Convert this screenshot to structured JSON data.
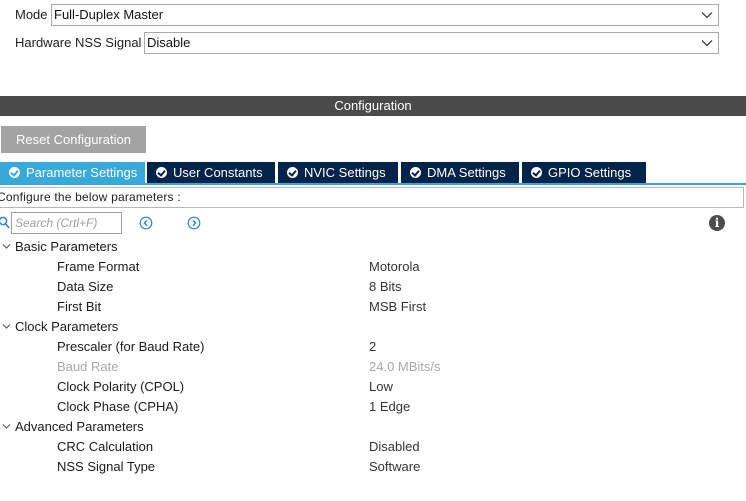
{
  "mode": {
    "label": "Mode",
    "value": "Full-Duplex Master"
  },
  "nss": {
    "label": "Hardware NSS Signal",
    "value": "Disable"
  },
  "config_header": "Configuration",
  "reset_button": "Reset Configuration",
  "tabs": [
    {
      "label": "Parameter Settings",
      "active": true
    },
    {
      "label": "User Constants",
      "active": false
    },
    {
      "label": "NVIC Settings",
      "active": false
    },
    {
      "label": "DMA Settings",
      "active": false
    },
    {
      "label": "GPIO Settings",
      "active": false
    }
  ],
  "hint": "Configure the below parameters :",
  "search": {
    "placeholder": "Search (Crtl+F)"
  },
  "groups": [
    {
      "label": "Basic Parameters",
      "params": [
        {
          "name": "Frame Format",
          "value": "Motorola",
          "disabled": false
        },
        {
          "name": "Data Size",
          "value": "8 Bits",
          "disabled": false
        },
        {
          "name": "First Bit",
          "value": "MSB First",
          "disabled": false
        }
      ]
    },
    {
      "label": "Clock Parameters",
      "params": [
        {
          "name": "Prescaler (for Baud Rate)",
          "value": "2",
          "disabled": false
        },
        {
          "name": "Baud Rate",
          "value": "24.0 MBits/s",
          "disabled": true
        },
        {
          "name": "Clock Polarity (CPOL)",
          "value": "Low",
          "disabled": false
        },
        {
          "name": "Clock Phase (CPHA)",
          "value": "1 Edge",
          "disabled": false
        }
      ]
    },
    {
      "label": "Advanced Parameters",
      "params": [
        {
          "name": "CRC Calculation",
          "value": "Disabled",
          "disabled": false
        },
        {
          "name": "NSS Signal Type",
          "value": "Software",
          "disabled": false
        }
      ]
    }
  ],
  "colors": {
    "tab_active": "#39a9dc",
    "tab_inactive": "#03234b",
    "header_bar": "#4a4a4a",
    "reset_button": "#a3a3a3",
    "disabled_text": "#a8a8a8"
  },
  "icons": {
    "dropdown": "chevron-down-icon",
    "tab_status": "check-circle-icon",
    "search": "search-icon",
    "previous": "previous-icon",
    "next": "next-icon",
    "info": "info-icon",
    "group_toggle": "caret-down-icon"
  }
}
